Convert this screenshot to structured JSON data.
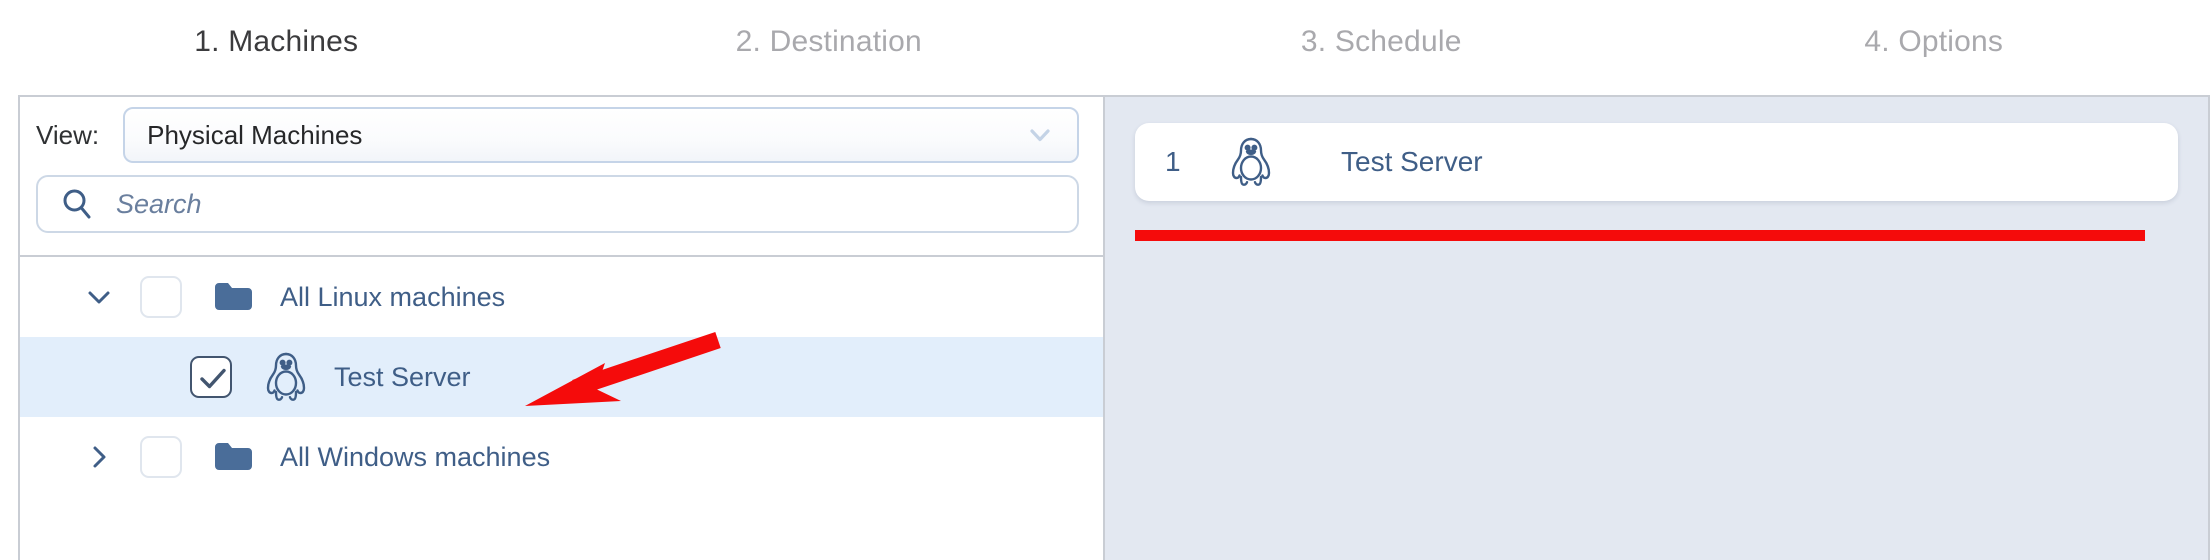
{
  "wizard": {
    "tabs": [
      {
        "label": "1. Machines",
        "state": "active"
      },
      {
        "label": "2. Destination",
        "state": "inactive"
      },
      {
        "label": "3. Schedule",
        "state": "inactive"
      },
      {
        "label": "4. Options",
        "state": "inactive"
      }
    ]
  },
  "left_panel": {
    "view": {
      "label": "View:",
      "selected": "Physical Machines",
      "chevron_icon": "chevron-down-icon"
    },
    "search": {
      "value": "",
      "placeholder": "Search",
      "icon": "search-icon"
    },
    "tree": [
      {
        "label": "All Linux machines",
        "icon": "folder-icon",
        "twisty": "chevron-down-icon",
        "expanded": true,
        "checked": false,
        "selected": false,
        "depth": 0
      },
      {
        "label": "Test Server",
        "icon": "tux-penguin-icon",
        "twisty": "none",
        "expanded": false,
        "checked": true,
        "selected": true,
        "depth": 1
      },
      {
        "label": "All Windows machines",
        "icon": "folder-icon",
        "twisty": "chevron-right-icon",
        "expanded": false,
        "checked": false,
        "selected": false,
        "depth": 0
      }
    ]
  },
  "right_panel": {
    "selected_items": [
      {
        "index": "1",
        "label": "Test Server",
        "icon": "tux-penguin-icon"
      }
    ]
  },
  "annotations": {
    "arrow_color": "#f50b0b",
    "underline_color": "#f50b0b"
  },
  "colors": {
    "accent_blue": "#3f5e87",
    "folder_blue": "#4a6d99",
    "selected_row": "#e2eefb",
    "right_panel_bg": "#e3e8f1",
    "active_tab_text": "#3b3b3d",
    "inactive_tab_text": "#a9a9ad"
  }
}
